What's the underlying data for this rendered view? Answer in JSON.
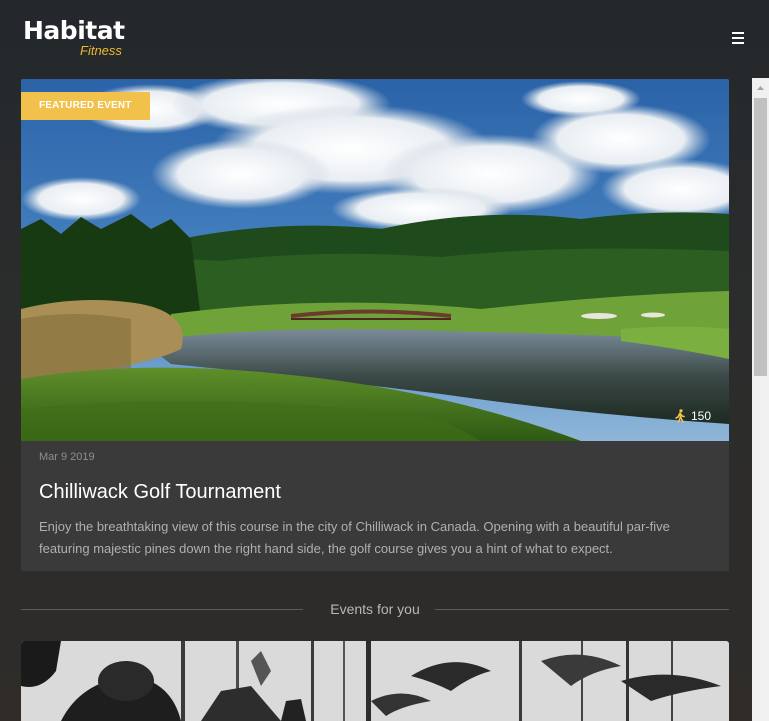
{
  "brand": {
    "name": "Habitat",
    "tagline": "Fitness",
    "accent_color": "#f2c14b"
  },
  "header": {
    "menu_icon": "hamburger-menu-icon"
  },
  "featured": {
    "badge": "FEATURED EVENT",
    "participants_icon": "walking-person-icon",
    "participants_count": "150",
    "date": "Mar 9 2019",
    "title": "Chilliwack Golf Tournament",
    "description": "Enjoy the breathtaking view of this course in the city of Chilliwack in Canada. Opening with a beautiful par-five featuring majestic pines down the right hand side, the golf course gives you a hint of what to expect."
  },
  "events_section": {
    "heading": "Events for you"
  }
}
